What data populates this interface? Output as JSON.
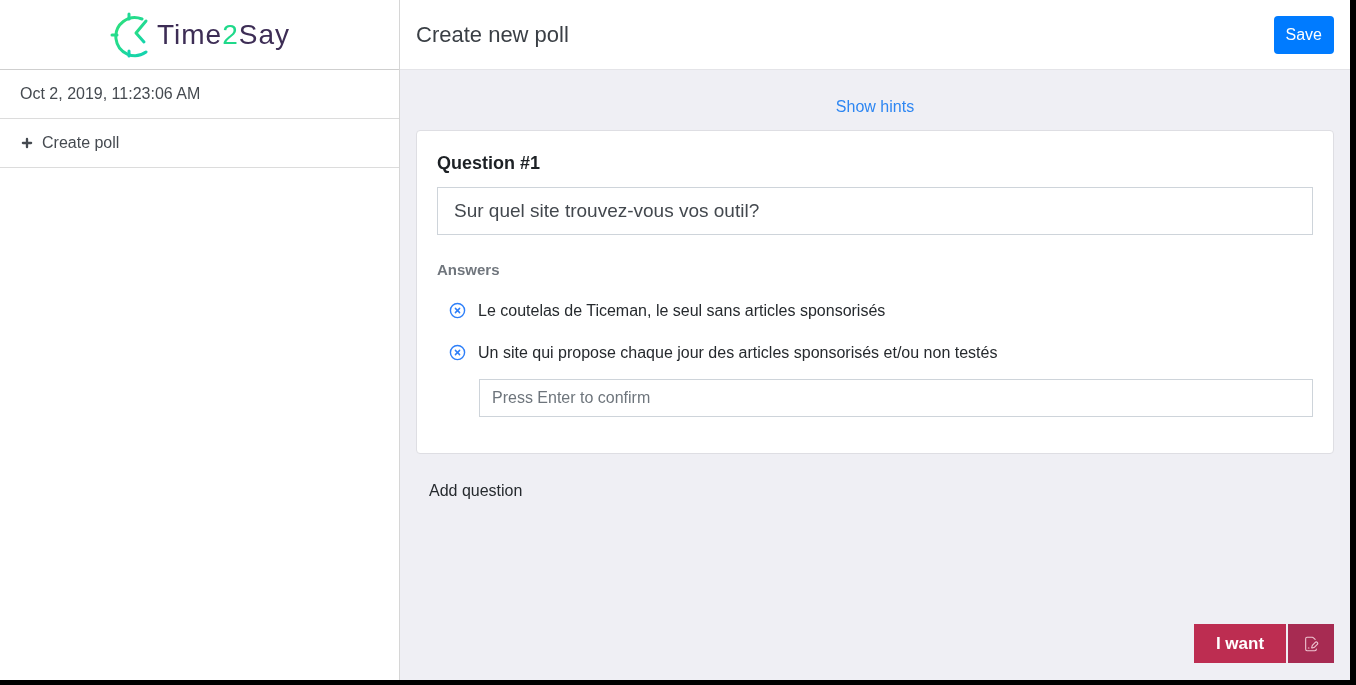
{
  "sidebar": {
    "logo": {
      "parts": [
        {
          "text": "Time",
          "color": "#3d2d55"
        },
        {
          "text": "2",
          "color": "#1fd98a"
        },
        {
          "text": "Say",
          "color": "#3d2d55"
        }
      ]
    },
    "timestamp": "Oct 2, 2019, 11:23:06 AM",
    "items": [
      {
        "label": "Create poll"
      }
    ]
  },
  "header": {
    "title": "Create new poll",
    "save_button": "Save"
  },
  "hints_link": "Show hints",
  "question": {
    "heading": "Question #1",
    "value": "Sur quel site trouvez-vous vos outil?",
    "answers_label": "Answers",
    "answers": [
      "Le coutelas de Ticeman, le seul sans articles sponsorisés",
      "Un site qui propose chaque jour des articles sponsorisés et/ou non testés"
    ],
    "new_answer": {
      "placeholder": "Press Enter to confirm"
    }
  },
  "add_question": "Add question",
  "feedback": {
    "label": "I want"
  }
}
